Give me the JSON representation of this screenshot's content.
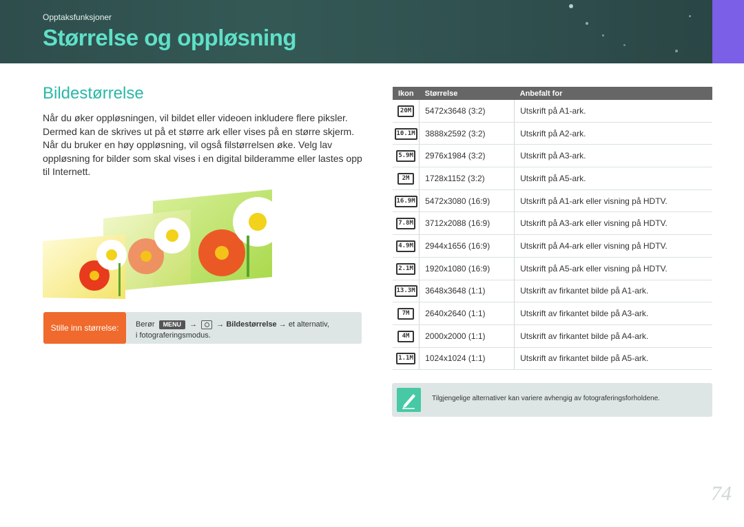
{
  "header": {
    "section": "Opptaksfunksjoner",
    "title": "Størrelse og oppløsning"
  },
  "content": {
    "heading": "Bildestørrelse",
    "paragraph": "Når du øker oppløsningen, vil bildet eller videoen inkludere flere piksler. Dermed kan de skrives ut på et større ark eller vises på en større skjerm. Når du bruker en høy oppløsning, vil også filstørrelsen øke. Velg lav oppløsning for bilder som skal vises i en digital bilderamme eller lastes opp til Internett."
  },
  "callout": {
    "label": "Stille inn størrelse:",
    "prefix": "Berør",
    "menu_key": "MENU",
    "arrow1": "→",
    "arrow2": "→",
    "menu_item": "Bildestørrelse",
    "arrow3": "→",
    "suffix": "et alternativ,",
    "line2": "i fotograferingsmodus."
  },
  "table": {
    "headers": [
      "Ikon",
      "Størrelse",
      "Anbefalt for"
    ],
    "rows": [
      {
        "icon": "20M",
        "size": "5472x3648 (3:2)",
        "use": "Utskrift på A1-ark."
      },
      {
        "icon": "10.1M",
        "size": "3888x2592 (3:2)",
        "use": "Utskrift på A2-ark."
      },
      {
        "icon": "5.9M",
        "size": "2976x1984 (3:2)",
        "use": "Utskrift på A3-ark."
      },
      {
        "icon": "2M",
        "size": "1728x1152 (3:2)",
        "use": "Utskrift på A5-ark."
      },
      {
        "icon": "16.9M",
        "size": "5472x3080 (16:9)",
        "use": "Utskrift på A1-ark eller visning på HDTV."
      },
      {
        "icon": "7.8M",
        "size": "3712x2088 (16:9)",
        "use": "Utskrift på A3-ark eller visning på HDTV."
      },
      {
        "icon": "4.9M",
        "size": "2944x1656 (16:9)",
        "use": "Utskrift på A4-ark eller visning på HDTV."
      },
      {
        "icon": "2.1M",
        "size": "1920x1080 (16:9)",
        "use": "Utskrift på A5-ark eller visning på HDTV."
      },
      {
        "icon": "13.3M",
        "size": "3648x3648 (1:1)",
        "use": "Utskrift av firkantet bilde på A1-ark."
      },
      {
        "icon": "7M",
        "size": "2640x2640 (1:1)",
        "use": "Utskrift av firkantet bilde på A3-ark."
      },
      {
        "icon": "4M",
        "size": "2000x2000 (1:1)",
        "use": "Utskrift av firkantet bilde på A4-ark."
      },
      {
        "icon": "1.1M",
        "size": "1024x1024 (1:1)",
        "use": "Utskrift av firkantet bilde på A5-ark."
      }
    ]
  },
  "note": {
    "icon": "pencil-note-icon",
    "text": "Tilgjengelige alternativer kan variere avhengig av fotograferingsforholdene."
  },
  "page_number": "74",
  "colors": {
    "banner": "#345955",
    "title": "#5fe0c8",
    "heading": "#29b8a6",
    "accent_tab": "#7b5fe6",
    "callout_label": "#ef6a2c",
    "note_icon": "#46c9a4"
  }
}
